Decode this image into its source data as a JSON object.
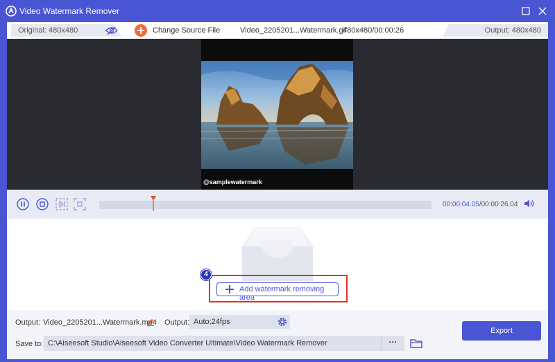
{
  "window": {
    "title": "Video Watermark Remover"
  },
  "infobar": {
    "original": "Original: 480x480",
    "change_source": "Change Source File",
    "file_name": "Video_2205201...Watermark.gif",
    "file_meta": "480x480/00:00:26",
    "output": "Output: 480x480"
  },
  "preview": {
    "watermark_text": "@samplewatermark"
  },
  "playback": {
    "current_time": "00:00:04.05",
    "total_time": "/00:00:26.04",
    "progress": 0.16
  },
  "area": {
    "step_badge": "4",
    "add_button": "Add watermark removing area"
  },
  "bottom": {
    "output_label": "Output:",
    "output_file": "Video_2205201...Watermark.mp4",
    "output_settings_label": "Output:",
    "output_settings_value": "Auto;24fps",
    "save_to_label": "Save to:",
    "save_path": "C:\\Aiseesoft Studio\\Aiseesoft Video Converter Ultimate\\Video Watermark Remover",
    "browse_label": "···",
    "export_label": "Export"
  },
  "colors": {
    "accent": "#4a55d4",
    "highlight": "#e03030",
    "change_source_icon": "#f26a3a"
  },
  "icons": [
    "app-logo-icon",
    "eye-slash-icon",
    "plus-circle-icon",
    "pause-icon",
    "stop-icon",
    "next-frame-icon",
    "crop-frame-icon",
    "playhead-icon",
    "volume-icon",
    "tray-icon",
    "plus-icon",
    "pencil-icon",
    "gear-icon",
    "folder-icon",
    "maximize-icon",
    "close-icon"
  ]
}
